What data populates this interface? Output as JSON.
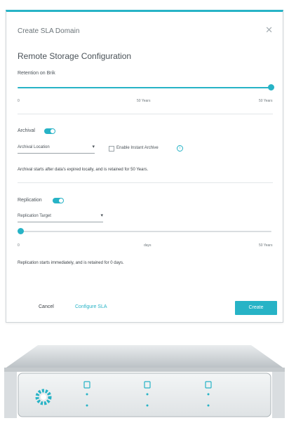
{
  "dialog": {
    "title": "Create SLA Domain",
    "close_glyph": "✕",
    "section_title": "Remote Storage Configuration",
    "retention": {
      "label": "Retention on Brik",
      "ticks": [
        "0",
        "50 Years",
        "50 Years"
      ]
    },
    "archival": {
      "label": "Archival",
      "location_placeholder": "Archival Location",
      "instant_archive_label": "Enable Instant Archive",
      "info_glyph": "i",
      "note": "Archival starts after data's expired locally, and is retained for 50 Years."
    },
    "replication": {
      "label": "Replication",
      "target_placeholder": "Replication Target",
      "ticks": [
        "0",
        "days",
        "50 Years"
      ],
      "note": "Replication starts immediately, and is retained for 0 days."
    },
    "footer": {
      "cancel": "Cancel",
      "configure": "Configure SLA",
      "create": "Create"
    }
  },
  "colors": {
    "accent": "#27b3c6",
    "track_grey": "#d9dde0",
    "text": "#3a3f44"
  },
  "icons": {
    "caret": "▾",
    "appliance_logo": "rubrik-logo-icon",
    "bay_icon": "drive-bay-icon",
    "status_dot": "status-light-icon"
  },
  "progress": {
    "retention_fraction": 1.0,
    "replication_fraction": 0.0
  }
}
